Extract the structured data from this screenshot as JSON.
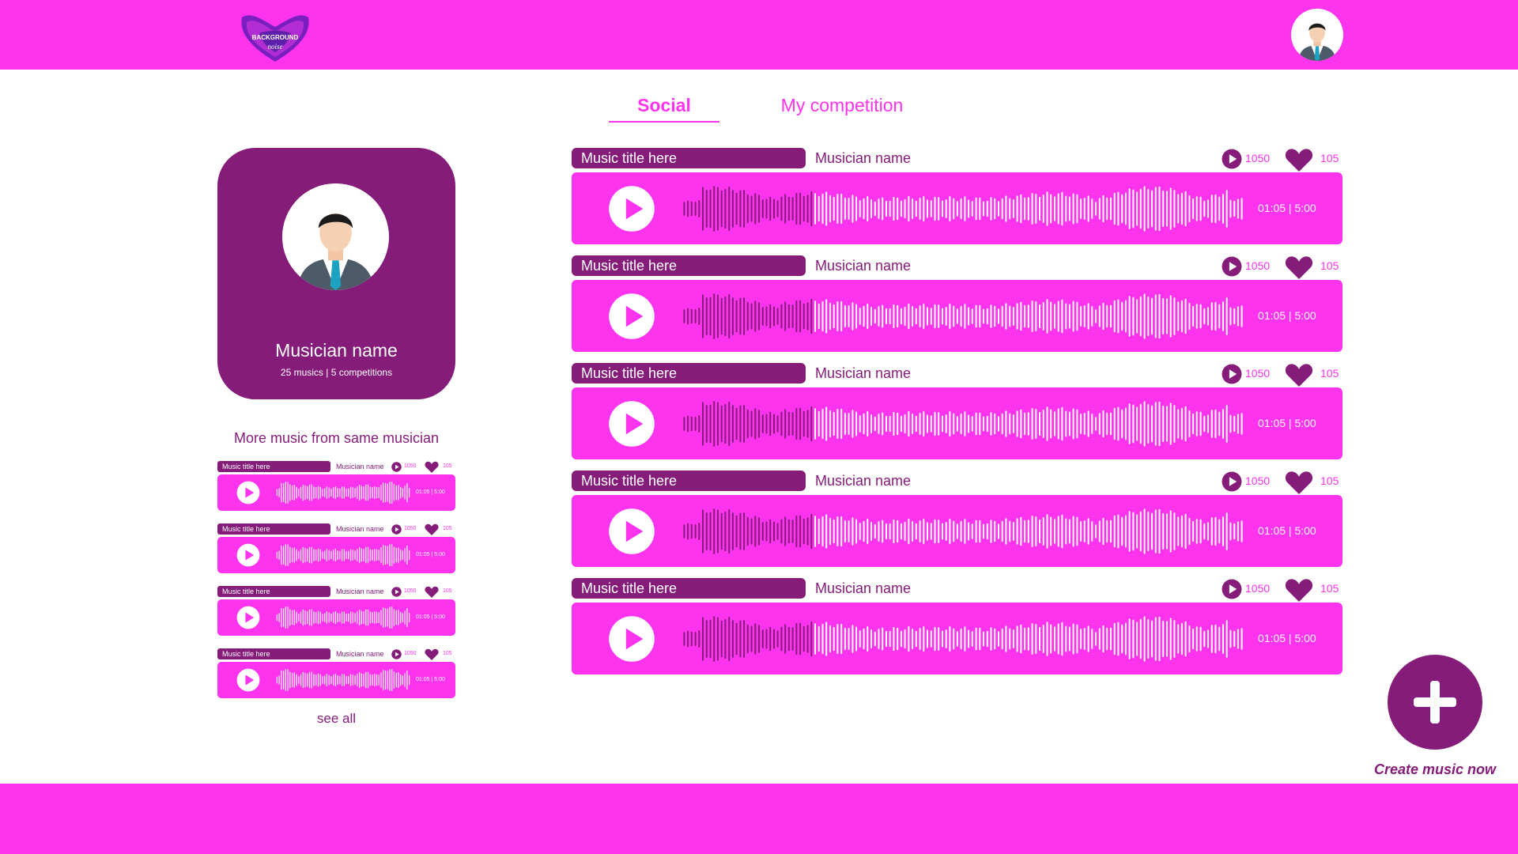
{
  "header": {
    "logo_text_1": "BACKGROUND",
    "logo_text_2": "noise"
  },
  "tabs": [
    {
      "label": "Social",
      "active": true
    },
    {
      "label": "My competition",
      "active": false
    }
  ],
  "profile": {
    "name": "Musician name",
    "stats": "25 musics  |  5 competitions"
  },
  "more_section": {
    "heading": "More music from same musician",
    "see_all": "see all"
  },
  "tracks": [
    {
      "title": "Music title here",
      "musician": "Musician name",
      "plays": "1050",
      "likes": "105",
      "time": "01:05 | 5:00"
    },
    {
      "title": "Music title here",
      "musician": "Musician name",
      "plays": "1050",
      "likes": "105",
      "time": "01:05 | 5:00"
    },
    {
      "title": "Music title here",
      "musician": "Musician name",
      "plays": "1050",
      "likes": "105",
      "time": "01:05 | 5:00"
    },
    {
      "title": "Music title here",
      "musician": "Musician name",
      "plays": "1050",
      "likes": "105",
      "time": "01:05 | 5:00"
    },
    {
      "title": "Music title here",
      "musician": "Musician name",
      "plays": "1050",
      "likes": "105",
      "time": "01:05 | 5:00"
    }
  ],
  "small_tracks": [
    {
      "title": "Music title here",
      "musician": "Musician name",
      "plays": "1050",
      "likes": "105",
      "time": "01:05 | 5:00"
    },
    {
      "title": "Music title here",
      "musician": "Musician name",
      "plays": "1050",
      "likes": "105",
      "time": "01:05 | 5:00"
    },
    {
      "title": "Music title here",
      "musician": "Musician name",
      "plays": "1050",
      "likes": "105",
      "time": "01:05 | 5:00"
    },
    {
      "title": "Music title here",
      "musician": "Musician name",
      "plays": "1050",
      "likes": "105",
      "time": "01:05 | 5:00"
    }
  ],
  "create": {
    "label": "Create music now"
  },
  "colors": {
    "pink": "#fd33ee",
    "purple": "#861c7a",
    "white": "#ffffff"
  }
}
